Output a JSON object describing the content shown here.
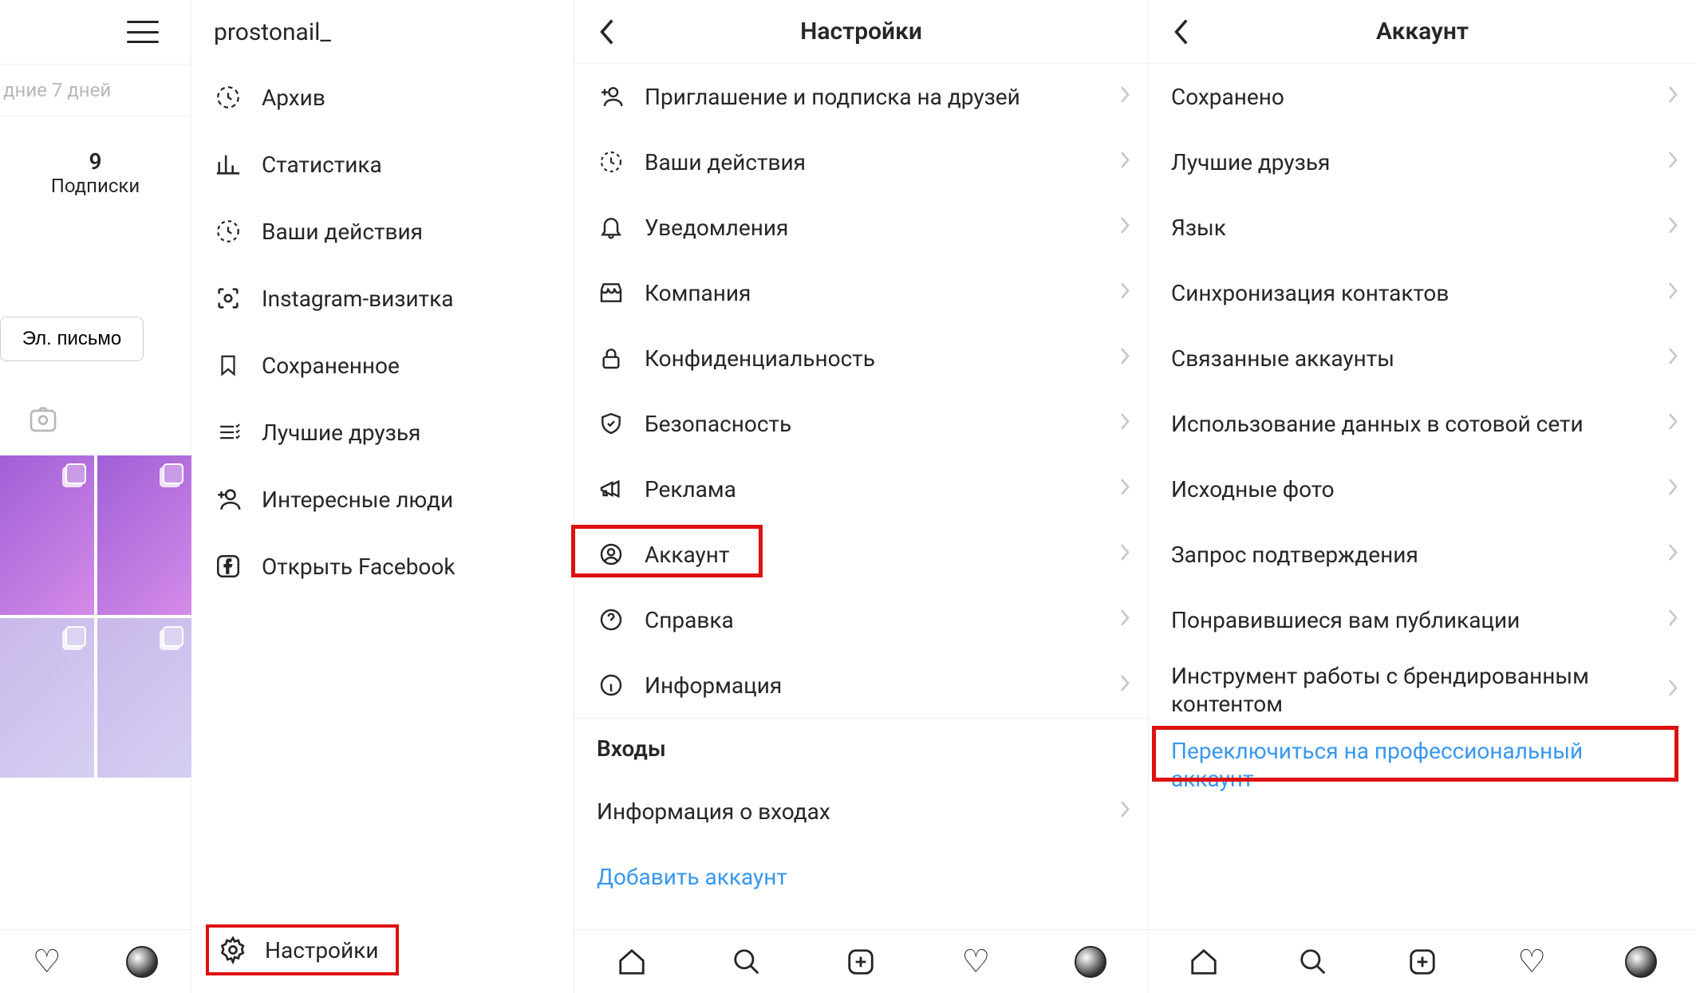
{
  "left": {
    "days_label": "дние 7 дней",
    "subs_count": "9",
    "subs_label": "Подписки",
    "email_button": "Эл. письмо"
  },
  "menu": {
    "username": "prostonail_",
    "items": [
      {
        "label": "Архив"
      },
      {
        "label": "Статистика"
      },
      {
        "label": "Ваши действия"
      },
      {
        "label": "Instagram-визитка"
      },
      {
        "label": "Сохраненное"
      },
      {
        "label": "Лучшие друзья"
      },
      {
        "label": "Интересные люди"
      },
      {
        "label": "Открыть Facebook"
      }
    ],
    "settings_label": "Настройки"
  },
  "settings": {
    "title": "Настройки",
    "rows": [
      {
        "label": "Приглашение и подписка на друзей"
      },
      {
        "label": "Ваши действия"
      },
      {
        "label": "Уведомления"
      },
      {
        "label": "Компания"
      },
      {
        "label": "Конфиденциальность"
      },
      {
        "label": "Безопасность"
      },
      {
        "label": "Реклама"
      },
      {
        "label": "Аккаунт"
      },
      {
        "label": "Справка"
      },
      {
        "label": "Информация"
      }
    ],
    "logins_header": "Входы",
    "login_info": "Информация о входах",
    "add_account": "Добавить аккаунт"
  },
  "account": {
    "title": "Аккаунт",
    "rows": [
      {
        "label": "Сохранено"
      },
      {
        "label": "Лучшие друзья"
      },
      {
        "label": "Язык"
      },
      {
        "label": "Синхронизация контактов"
      },
      {
        "label": "Связанные аккаунты"
      },
      {
        "label": "Использование данных в сотовой сети"
      },
      {
        "label": "Исходные фото"
      },
      {
        "label": "Запрос подтверждения"
      },
      {
        "label": "Понравившиеся вам публикации"
      },
      {
        "label": "Инструмент работы с брендированным контентом"
      }
    ],
    "switch_label": "Переключиться на профессиональный аккаунт"
  }
}
